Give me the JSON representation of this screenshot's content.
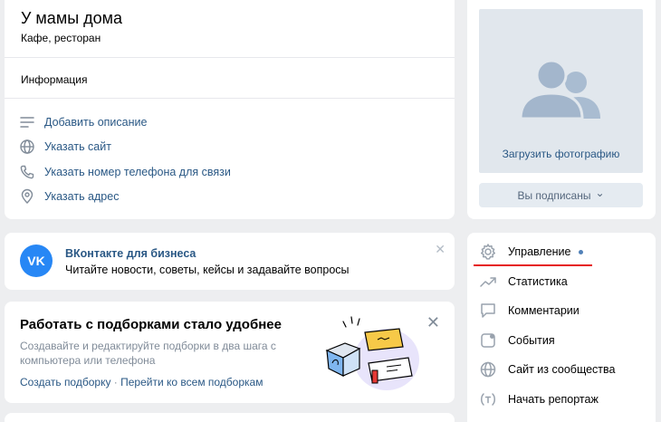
{
  "group": {
    "name": "У мамы дома",
    "category": "Кафе, ресторан",
    "info_title": "Информация",
    "info_actions": [
      {
        "label": "Добавить описание",
        "icon": "text-lines-icon"
      },
      {
        "label": "Указать сайт",
        "icon": "globe-icon"
      },
      {
        "label": "Указать номер телефона для связи",
        "icon": "phone-icon"
      },
      {
        "label": "Указать адрес",
        "icon": "location-pin-icon"
      }
    ]
  },
  "business_promo": {
    "logo_text": "VK",
    "title": "ВКонтакте для бизнеса",
    "subtitle": "Читайте новости, советы, кейсы и задавайте вопросы"
  },
  "collections_promo": {
    "title": "Работать с подборками стало удобнее",
    "description": "Создавайте и редактируйте подборки в два шага с компьютера или телефона",
    "link_create": "Создать подборку",
    "link_separator": " · ",
    "link_all": "Перейти ко всем подборкам"
  },
  "photo": {
    "upload_label": "Загрузить фотографию",
    "subscribed_label": "Вы подписаны",
    "subscribed_caret": "⌄"
  },
  "menu": {
    "items": [
      {
        "label": "Управление",
        "icon": "gear-icon"
      },
      {
        "label": "Статистика",
        "icon": "chart-trend-icon"
      },
      {
        "label": "Комментарии",
        "icon": "comment-icon"
      },
      {
        "label": "События",
        "icon": "calendar-icon"
      },
      {
        "label": "Сайт из сообщества",
        "icon": "globe-icon"
      },
      {
        "label": "Начать репортаж",
        "icon": "live-broadcast-icon"
      }
    ]
  },
  "colors": {
    "accent": "#2a5885",
    "background": "#edeef0",
    "vk_blue": "#2787f5",
    "underline": "#e61a1a"
  }
}
